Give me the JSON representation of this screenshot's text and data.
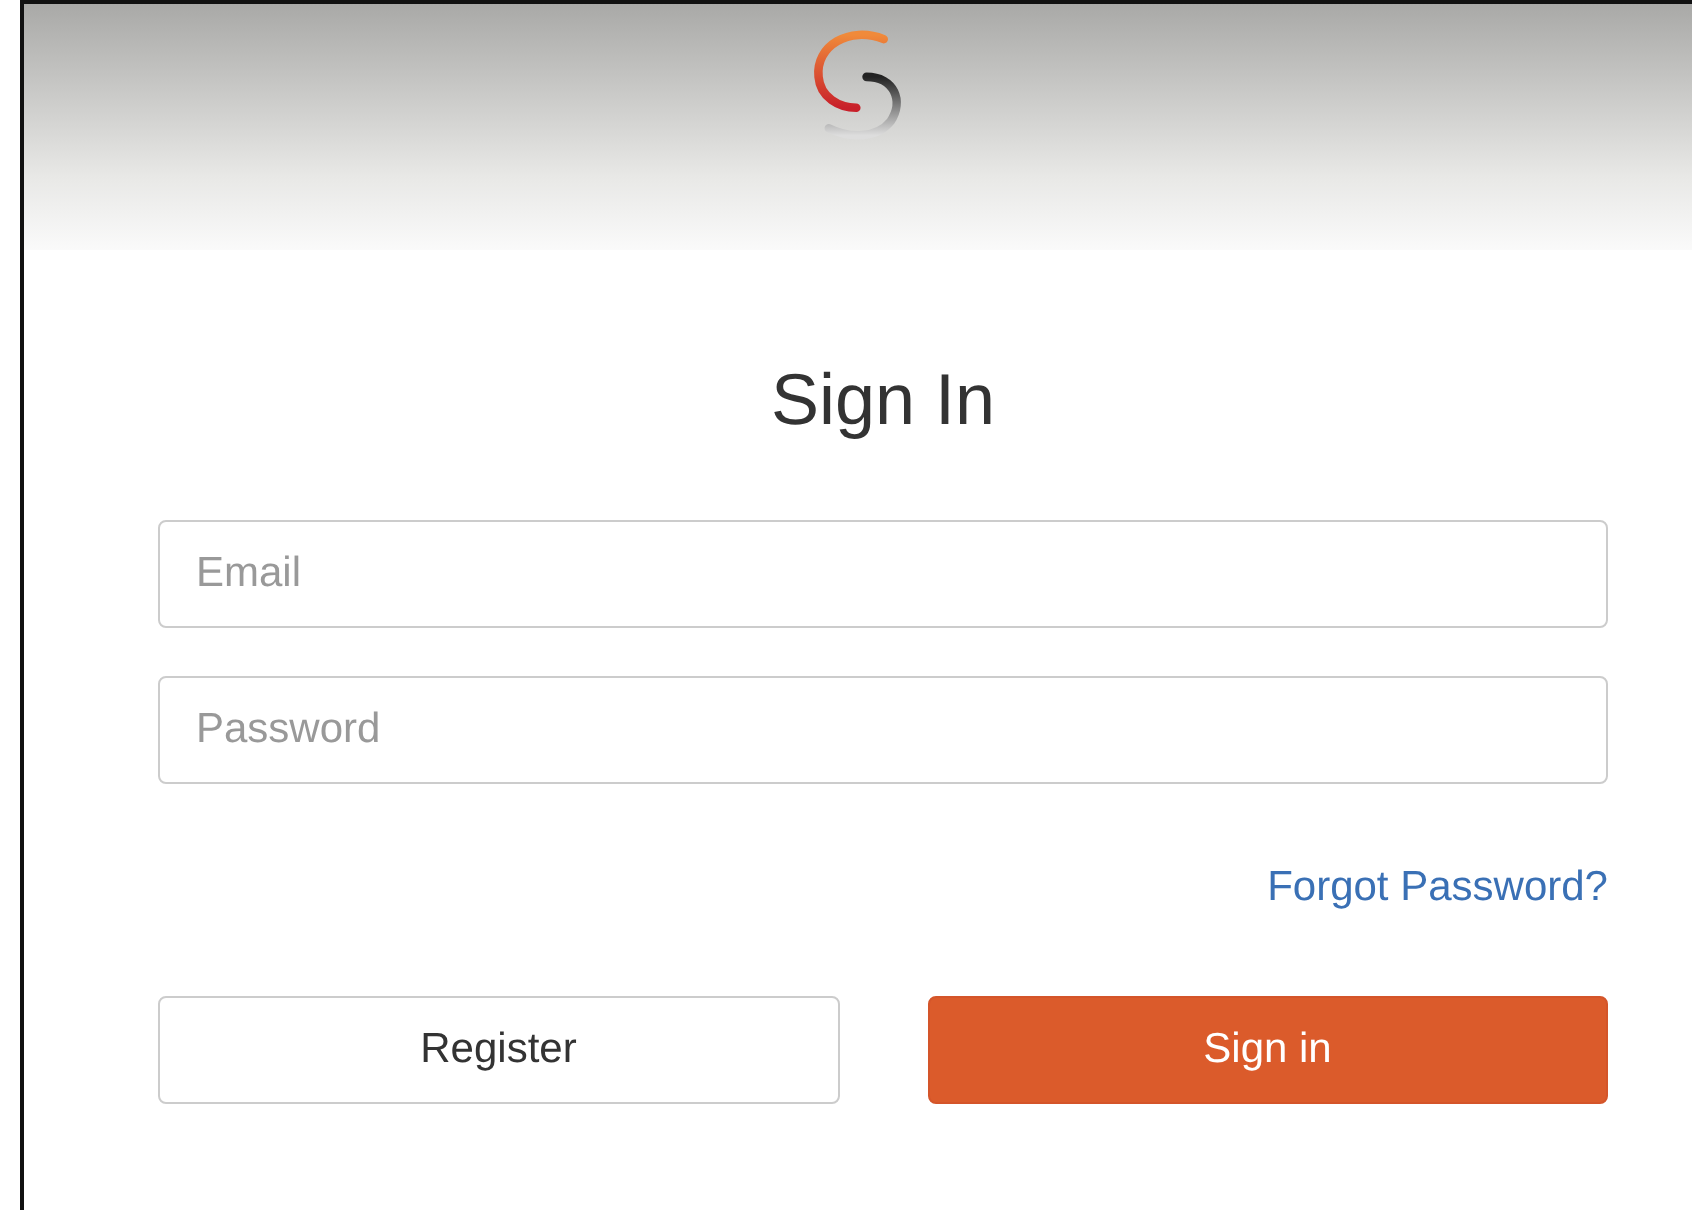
{
  "title": "Sign In",
  "fields": [
    {
      "placeholder": "Email"
    },
    {
      "placeholder": "Password"
    }
  ],
  "forgot_link": "Forgot Password?",
  "buttons": [
    {
      "label": "Register",
      "kind": "secondary"
    },
    {
      "label": "Sign in",
      "kind": "primary"
    }
  ]
}
